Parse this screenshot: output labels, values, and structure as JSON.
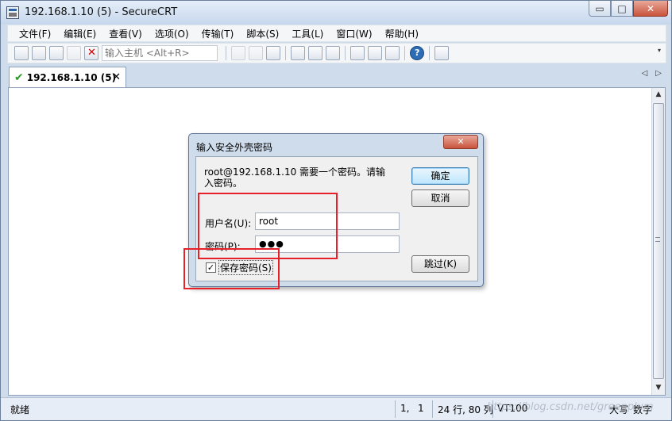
{
  "window": {
    "title": "192.168.1.10 (5) - SecureCRT",
    "min": "▭",
    "max": "□",
    "close": "✕"
  },
  "menu": [
    "文件(F)",
    "编辑(E)",
    "查看(V)",
    "选项(O)",
    "传输(T)",
    "脚本(S)",
    "工具(L)",
    "窗口(W)",
    "帮助(H)"
  ],
  "toolbar": {
    "host_placeholder": "输入主机 <Alt+R>",
    "icons": [
      "connect-icon",
      "quick-connect-icon",
      "connect-in-tab-icon",
      "reconnect-icon",
      "disconnect-icon",
      "copy-icon",
      "paste-icon",
      "find-icon",
      "print-icon",
      "print-setup-icon",
      "print-selection-icon",
      "session-options-icon",
      "global-options-icon",
      "keymap-icon",
      "help-icon",
      "sftp-icon"
    ]
  },
  "tab": {
    "label": "192.168.1.10 (5)",
    "close": "✕",
    "prev": "◁",
    "next": "▷"
  },
  "dialog": {
    "title": "输入安全外壳密码",
    "close": "✕",
    "message": "root@192.168.1.10 需要一个密码。请输入密码。",
    "username_label": "用户名(U):",
    "username_value": "root",
    "password_label": "密码(P):",
    "password_value": "●●●",
    "save_password_label": "保存密码(S)",
    "save_password_checked": "✓",
    "ok_label": "确定",
    "cancel_label": "取消",
    "skip_label": "跳过(K)"
  },
  "status": {
    "ready": "就绪",
    "row": "1,",
    "col": "1",
    "size": "24 行, 80 列",
    "terminal": "VT100",
    "caps": "大写",
    "num": "数字"
  },
  "watermark": "https://blog.csdn.net/greenplum",
  "colors": {
    "highlight": "#e8202a",
    "title_bg": "#cfdcec"
  }
}
